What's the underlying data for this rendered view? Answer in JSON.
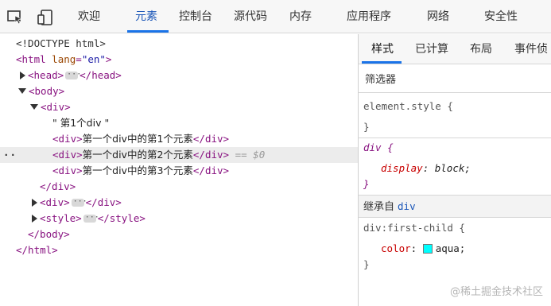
{
  "toolbar": {
    "icons": [
      "inspect-element-icon",
      "device-emulation-icon"
    ],
    "tabs": [
      "欢迎",
      "元素",
      "控制台",
      "源代码",
      "内存",
      "应用程序",
      "网络",
      "安全性"
    ],
    "active_tab": "元素"
  },
  "dom": {
    "doctype": "<!DOCTYPE html>",
    "html_open": "<html",
    "lang_attr": "lang",
    "lang_val": "\"en\"",
    "gt": ">",
    "head_open": "<head>",
    "head_close": "</head>",
    "body_open": "<body>",
    "div_open": "<div>",
    "text_node": "\" 第1个div \"",
    "child1_text": "第一个div中的第1个元素",
    "child2_text": "第一个div中的第2个元素",
    "child3_text": "第一个div中的第3个元素",
    "div_close": "</div>",
    "selected_marker": "== $0",
    "row_dots": "··",
    "style_open": "<style>",
    "style_close": "</style>",
    "body_close": "</body>",
    "html_close": "</html>"
  },
  "styles": {
    "tabs": [
      "样式",
      "已计算",
      "布局",
      "事件侦"
    ],
    "filter_placeholder": "筛选器",
    "element_style_selector": "element.style {",
    "close_brace": "}",
    "rule1_selector": "div {",
    "rule1_prop": "display",
    "rule1_colon": ":",
    "rule1_value": "block;",
    "inherited_label": "继承自",
    "inherited_from": "div",
    "rule2_selector": "div:first-child {",
    "rule2_prop": "color",
    "rule2_colon": ":",
    "rule2_value": "aqua;",
    "rule2_swatch_color": "#00ffff"
  },
  "watermark": "@稀土掘金技术社区",
  "colors": {
    "accent": "#1a73e8",
    "tag": "#881280",
    "attr": "#994500"
  }
}
